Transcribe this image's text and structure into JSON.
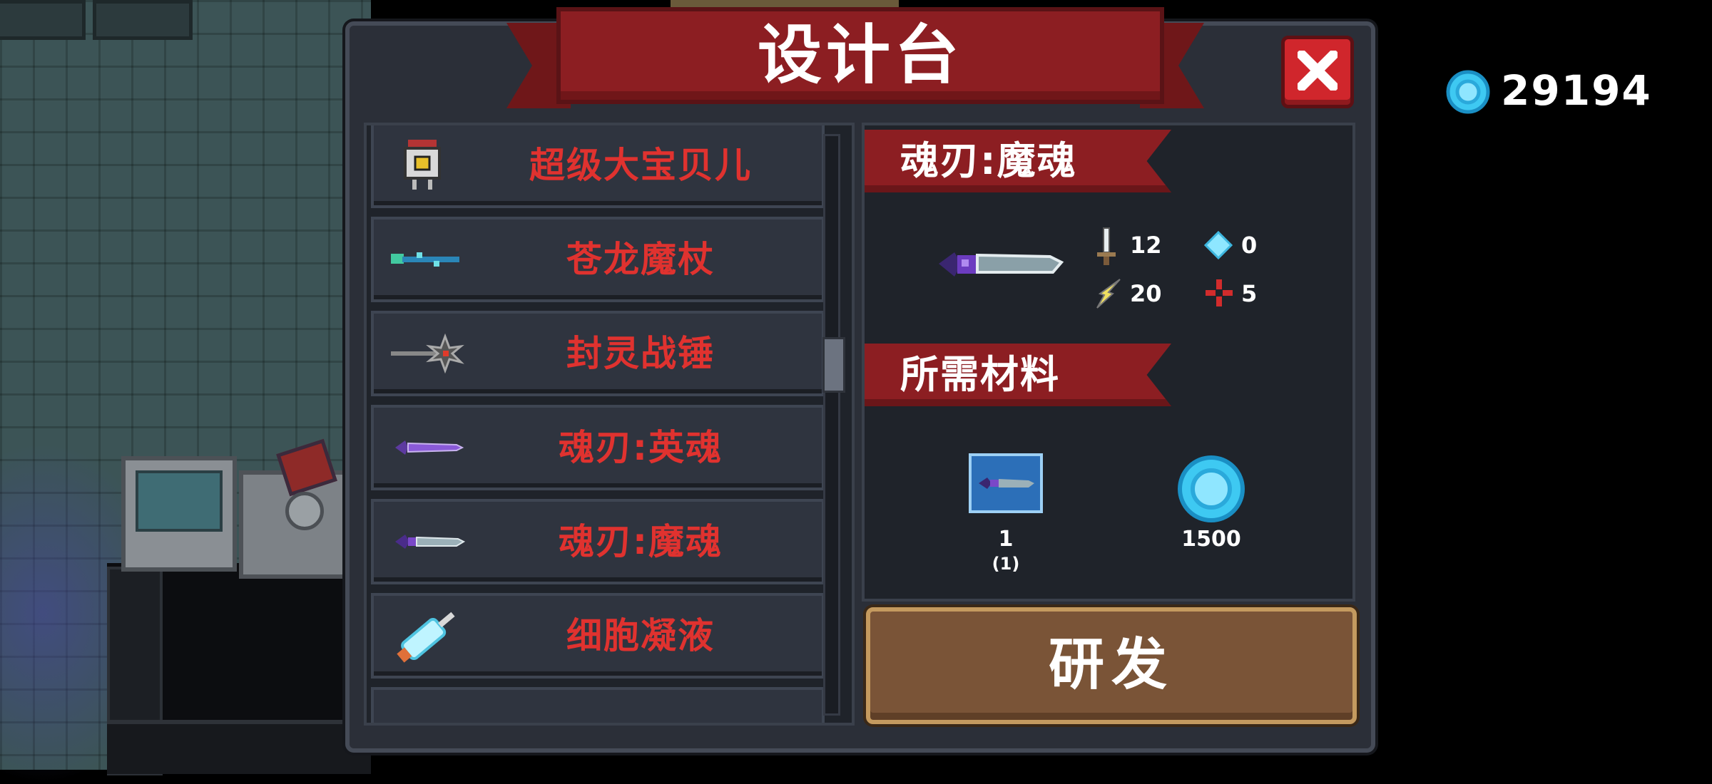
{
  "title": "设计台",
  "currency": {
    "value": "29194",
    "icon": "gem-icon"
  },
  "list": {
    "items": [
      {
        "label": "超级大宝贝儿",
        "icon": "robot-pet-icon"
      },
      {
        "label": "苍龙魔杖",
        "icon": "dragon-staff-icon"
      },
      {
        "label": "封灵战锤",
        "icon": "war-hammer-icon"
      },
      {
        "label": "魂刃:英魂",
        "icon": "soul-blade-purple-icon"
      },
      {
        "label": "魂刃:魔魂",
        "icon": "soul-blade-icon"
      },
      {
        "label": "细胞凝液",
        "icon": "syringe-icon"
      }
    ]
  },
  "detail": {
    "item_name": "魂刃:魔魂",
    "stats": {
      "attack": "12",
      "energy": "0",
      "crit": "20",
      "accuracy": "5"
    },
    "materials_heading": "所需材料",
    "materials": [
      {
        "icon": "blueprint-icon",
        "count": "1",
        "owned": "(1)"
      },
      {
        "icon": "gem-icon",
        "count": "1500"
      }
    ]
  },
  "build_button": "研发",
  "colors": {
    "accent_red": "#8c1e22",
    "list_text_red": "#e0322f",
    "panel_bg": "#2b2f38",
    "build_brown": "#7a5437",
    "gem_blue": "#3ec9f2"
  }
}
